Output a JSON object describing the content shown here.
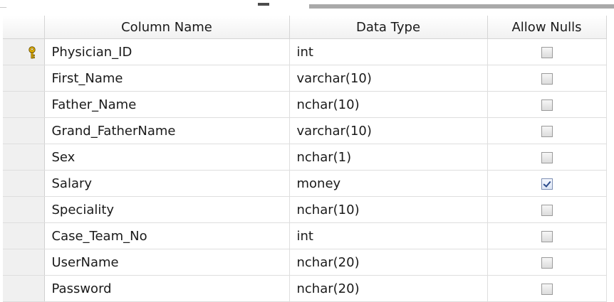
{
  "table": {
    "headers": {
      "column_name": "Column Name",
      "data_type": "Data Type",
      "allow_nulls": "Allow Nulls"
    },
    "rows": [
      {
        "name": "Physician_ID",
        "type": "int",
        "allow_nulls": false,
        "primary_key": true
      },
      {
        "name": "First_Name",
        "type": "varchar(10)",
        "allow_nulls": false,
        "primary_key": false
      },
      {
        "name": "Father_Name",
        "type": "nchar(10)",
        "allow_nulls": false,
        "primary_key": false
      },
      {
        "name": "Grand_FatherName",
        "type": "varchar(10)",
        "allow_nulls": false,
        "primary_key": false
      },
      {
        "name": "Sex",
        "type": "nchar(1)",
        "allow_nulls": false,
        "primary_key": false
      },
      {
        "name": "Salary",
        "type": "money",
        "allow_nulls": true,
        "primary_key": false
      },
      {
        "name": "Speciality",
        "type": "nchar(10)",
        "allow_nulls": false,
        "primary_key": false
      },
      {
        "name": "Case_Team_No",
        "type": "int",
        "allow_nulls": false,
        "primary_key": false
      },
      {
        "name": "UserName",
        "type": "nchar(20)",
        "allow_nulls": false,
        "primary_key": false
      },
      {
        "name": "Password",
        "type": "nchar(20)",
        "allow_nulls": false,
        "primary_key": false
      }
    ]
  },
  "icons": {
    "primary_key": "key-icon",
    "checkbox": "checkbox-icon"
  },
  "colors": {
    "key_gold": "#e8b400",
    "check_blue": "#2b4a8a",
    "row_selector_bg": "#f0f0f0"
  }
}
